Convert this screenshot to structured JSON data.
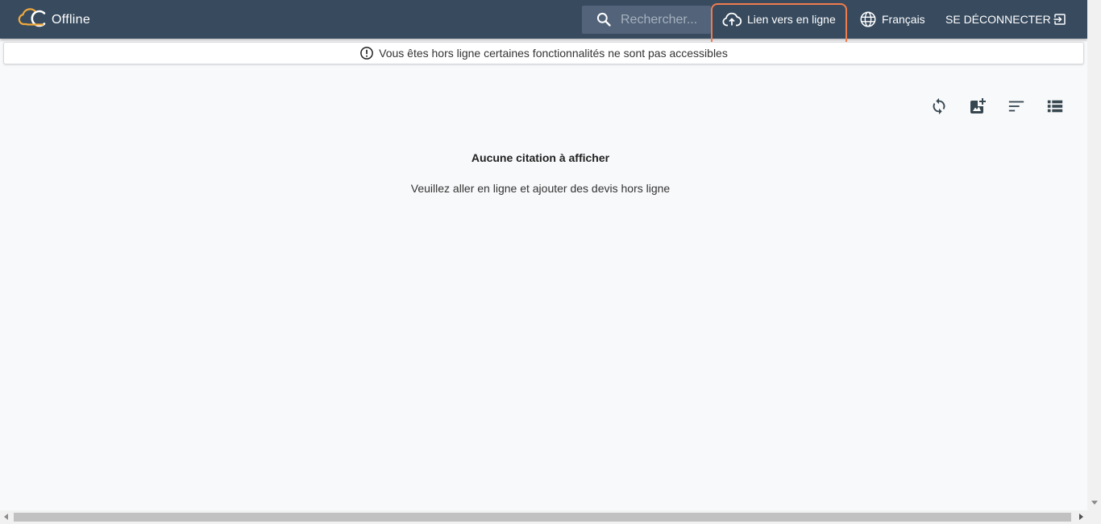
{
  "app": {
    "logo_text": "Offline",
    "brand_color": "#f2a93b"
  },
  "header": {
    "search_placeholder": "Rechercher...",
    "online_link_label": "Lien vers en ligne",
    "language_label": "Français",
    "logout_label": "SE DÉCONNECTER",
    "background_color": "#374a5e",
    "highlight_color": "#f07c4e"
  },
  "banner": {
    "message": "Vous êtes hors ligne certaines fonctionnalités ne sont pas accessibles",
    "icon": "alert-circle-icon"
  },
  "toolbar": {
    "icons": [
      "sync-icon",
      "add-image-icon",
      "sort-icon",
      "list-view-icon"
    ]
  },
  "empty_state": {
    "title": "Aucune citation à afficher",
    "subtitle": "Veuillez aller en ligne et ajouter des devis hors ligne"
  }
}
